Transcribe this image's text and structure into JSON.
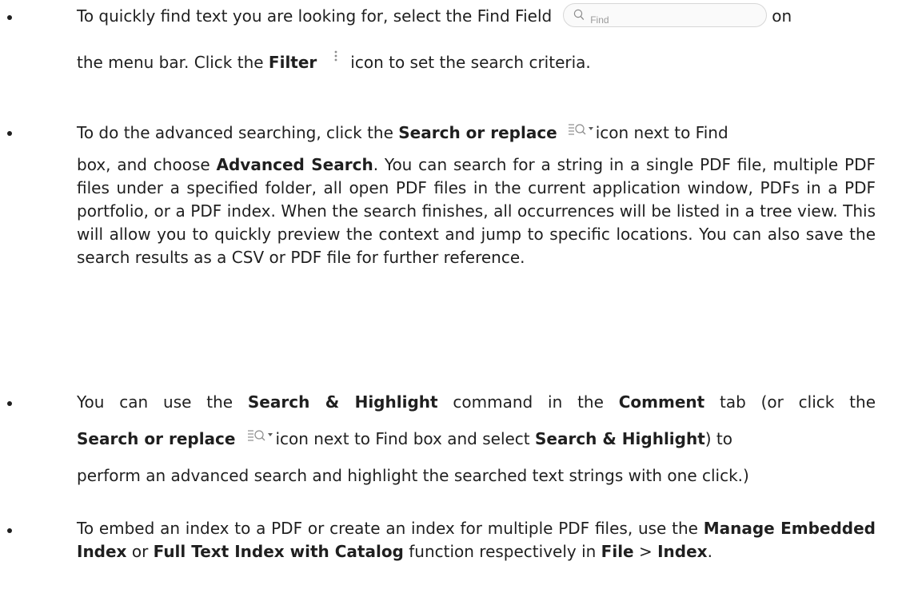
{
  "bullets": {
    "item1": {
      "t1": "To quickly find text you are looking for, select the Find Field",
      "find_placeholder": "Find",
      "t2": "on",
      "t3": "the menu bar. Click the ",
      "b1": "Filter",
      "t4": "icon to set the search criteria."
    },
    "item2": {
      "t1": "To do the advanced searching, click the ",
      "b1": "Search or replace",
      "t2": "icon next to Find",
      "t3": "box, and choose ",
      "b2": "Advanced Search",
      "t4": ". You can search for a string in a single PDF file, multiple PDF files under a specified folder, all open PDF files in the current application window, PDFs in a PDF portfolio, or a PDF index. When the search finishes, all occurrences will be listed in a tree view. This will allow you to quickly preview the context and jump to specific locations. You can also save the search results as a CSV or PDF file for further reference."
    },
    "item3": {
      "t1": "You can use the ",
      "b1": "Search & Highlight",
      "t2": " command in the ",
      "b2": "Comment",
      "t3": " tab (or click the",
      "b3": "Search or replace",
      "t4": "icon next to Find box and select ",
      "b4": "Search & Highlight",
      "t5": ") to",
      "t6": "perform an advanced search and highlight the searched text strings with one click.)"
    },
    "item4": {
      "t1": "To embed an index to a PDF or create an index for multiple PDF files, use the ",
      "b1": "Manage Embedded Index",
      "t2": " or ",
      "b2": "Full Text Index with Catalog",
      "t3": " function respectively in ",
      "b3": "File",
      "t4": " > ",
      "b4": "Index",
      "t5": "."
    }
  },
  "icons": {
    "find_field": "magnifier-icon",
    "filter": "vertical-ellipsis-icon",
    "search_replace": "search-or-replace-icon"
  },
  "colors": {
    "text": "#1f1f1f",
    "icon_gray": "#8c8c8c",
    "placeholder": "#9b9b9b"
  }
}
